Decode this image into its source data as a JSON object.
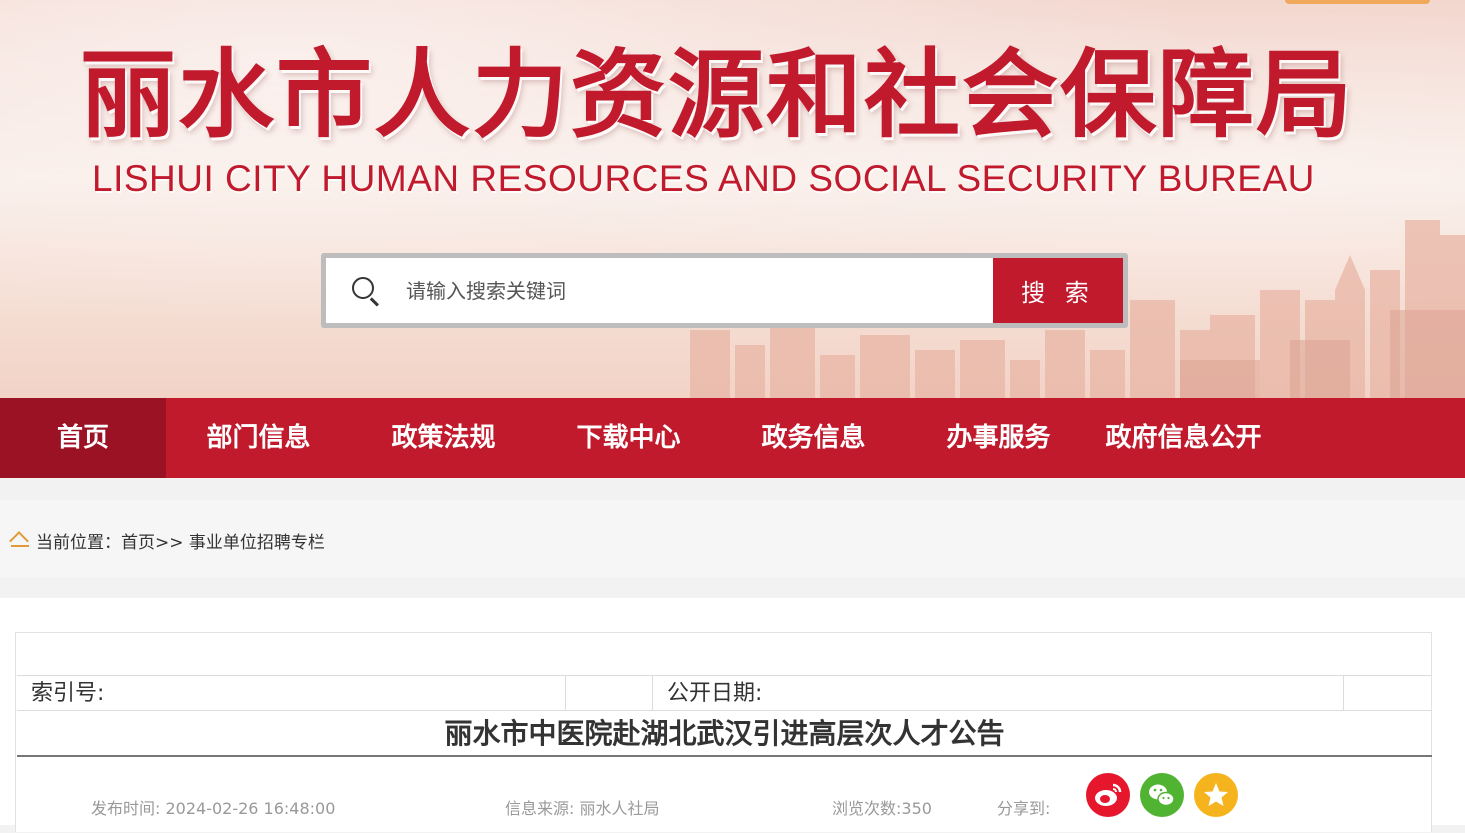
{
  "header": {
    "title_cn": "丽水市人力资源和社会保障局",
    "title_en": "LISHUI CITY HUMAN RESOURCES AND SOCIAL SECURITY BUREAU"
  },
  "search": {
    "placeholder": "请输入搜索关键词",
    "button_label": "搜 索"
  },
  "nav": {
    "items": [
      {
        "label": "首页",
        "active": true
      },
      {
        "label": "部门信息"
      },
      {
        "label": "政策法规"
      },
      {
        "label": "下载中心"
      },
      {
        "label": "政务信息"
      },
      {
        "label": "办事服务"
      },
      {
        "label": "政府信息公开"
      }
    ]
  },
  "breadcrumb": {
    "prefix": "当前位置：",
    "home": "首页>>",
    "current": " 事业单位招聘专栏"
  },
  "article": {
    "index_label": "索引号:",
    "date_label": "公开日期:",
    "title": "丽水市中医院赴湖北武汉引进高层次人才公告",
    "publish_time": "发布时间: 2024-02-26 16:48:00",
    "source": "信息来源: 丽水人社局",
    "views": "浏览次数:350",
    "share_label": "分享到:"
  },
  "colors": {
    "brand_red": "#c11a2d",
    "nav_active": "#9b1224",
    "weibo": "#e6162d",
    "wechat": "#51b332",
    "favorite": "#f5b41e"
  },
  "icons": [
    "search-icon",
    "home-icon",
    "weibo-icon",
    "wechat-icon",
    "star-icon"
  ]
}
